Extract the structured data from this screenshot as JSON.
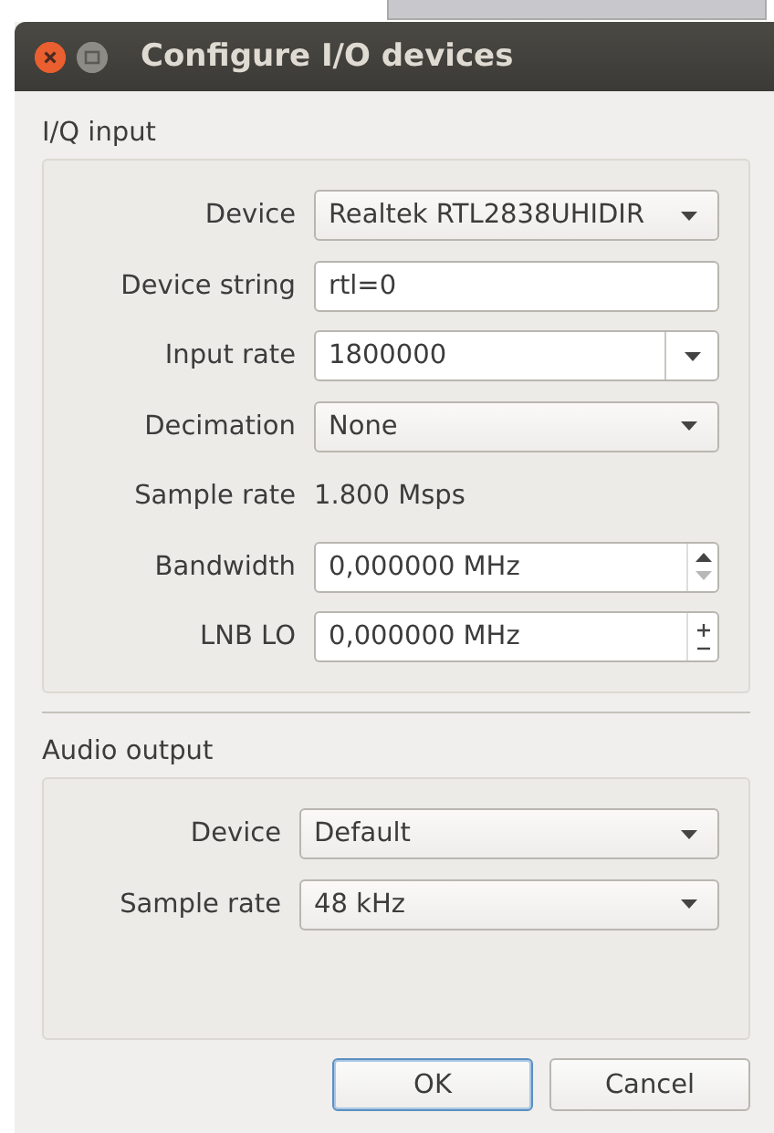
{
  "window": {
    "title": "Configure I/O devices"
  },
  "groups": [
    {
      "title": "I/Q input",
      "rows": [
        {
          "label": "Device",
          "kind": "combo",
          "value": "Realtek RTL2838UHIDIR"
        },
        {
          "label": "Device string",
          "kind": "entry",
          "value": "rtl=0"
        },
        {
          "label": "Input rate",
          "kind": "editable_combo",
          "value": "1800000"
        },
        {
          "label": "Decimation",
          "kind": "combo",
          "value": "None"
        },
        {
          "label": "Sample rate",
          "kind": "text",
          "value": "1.800 Msps"
        },
        {
          "label": "Bandwidth",
          "kind": "spin",
          "value": "0,000000 MHz",
          "up_enabled": true,
          "down_enabled": false
        },
        {
          "label": "LNB LO",
          "kind": "plusminus",
          "value": "0,000000 MHz",
          "up_enabled": true,
          "down_enabled": true
        }
      ]
    },
    {
      "title": "Audio output",
      "rows": [
        {
          "label": "Device",
          "kind": "combo",
          "value": "Default"
        },
        {
          "label": "Sample rate",
          "kind": "combo",
          "value": "48 kHz"
        }
      ]
    }
  ],
  "buttons": [
    {
      "label": "OK",
      "default": true
    },
    {
      "label": "Cancel",
      "default": false
    }
  ]
}
